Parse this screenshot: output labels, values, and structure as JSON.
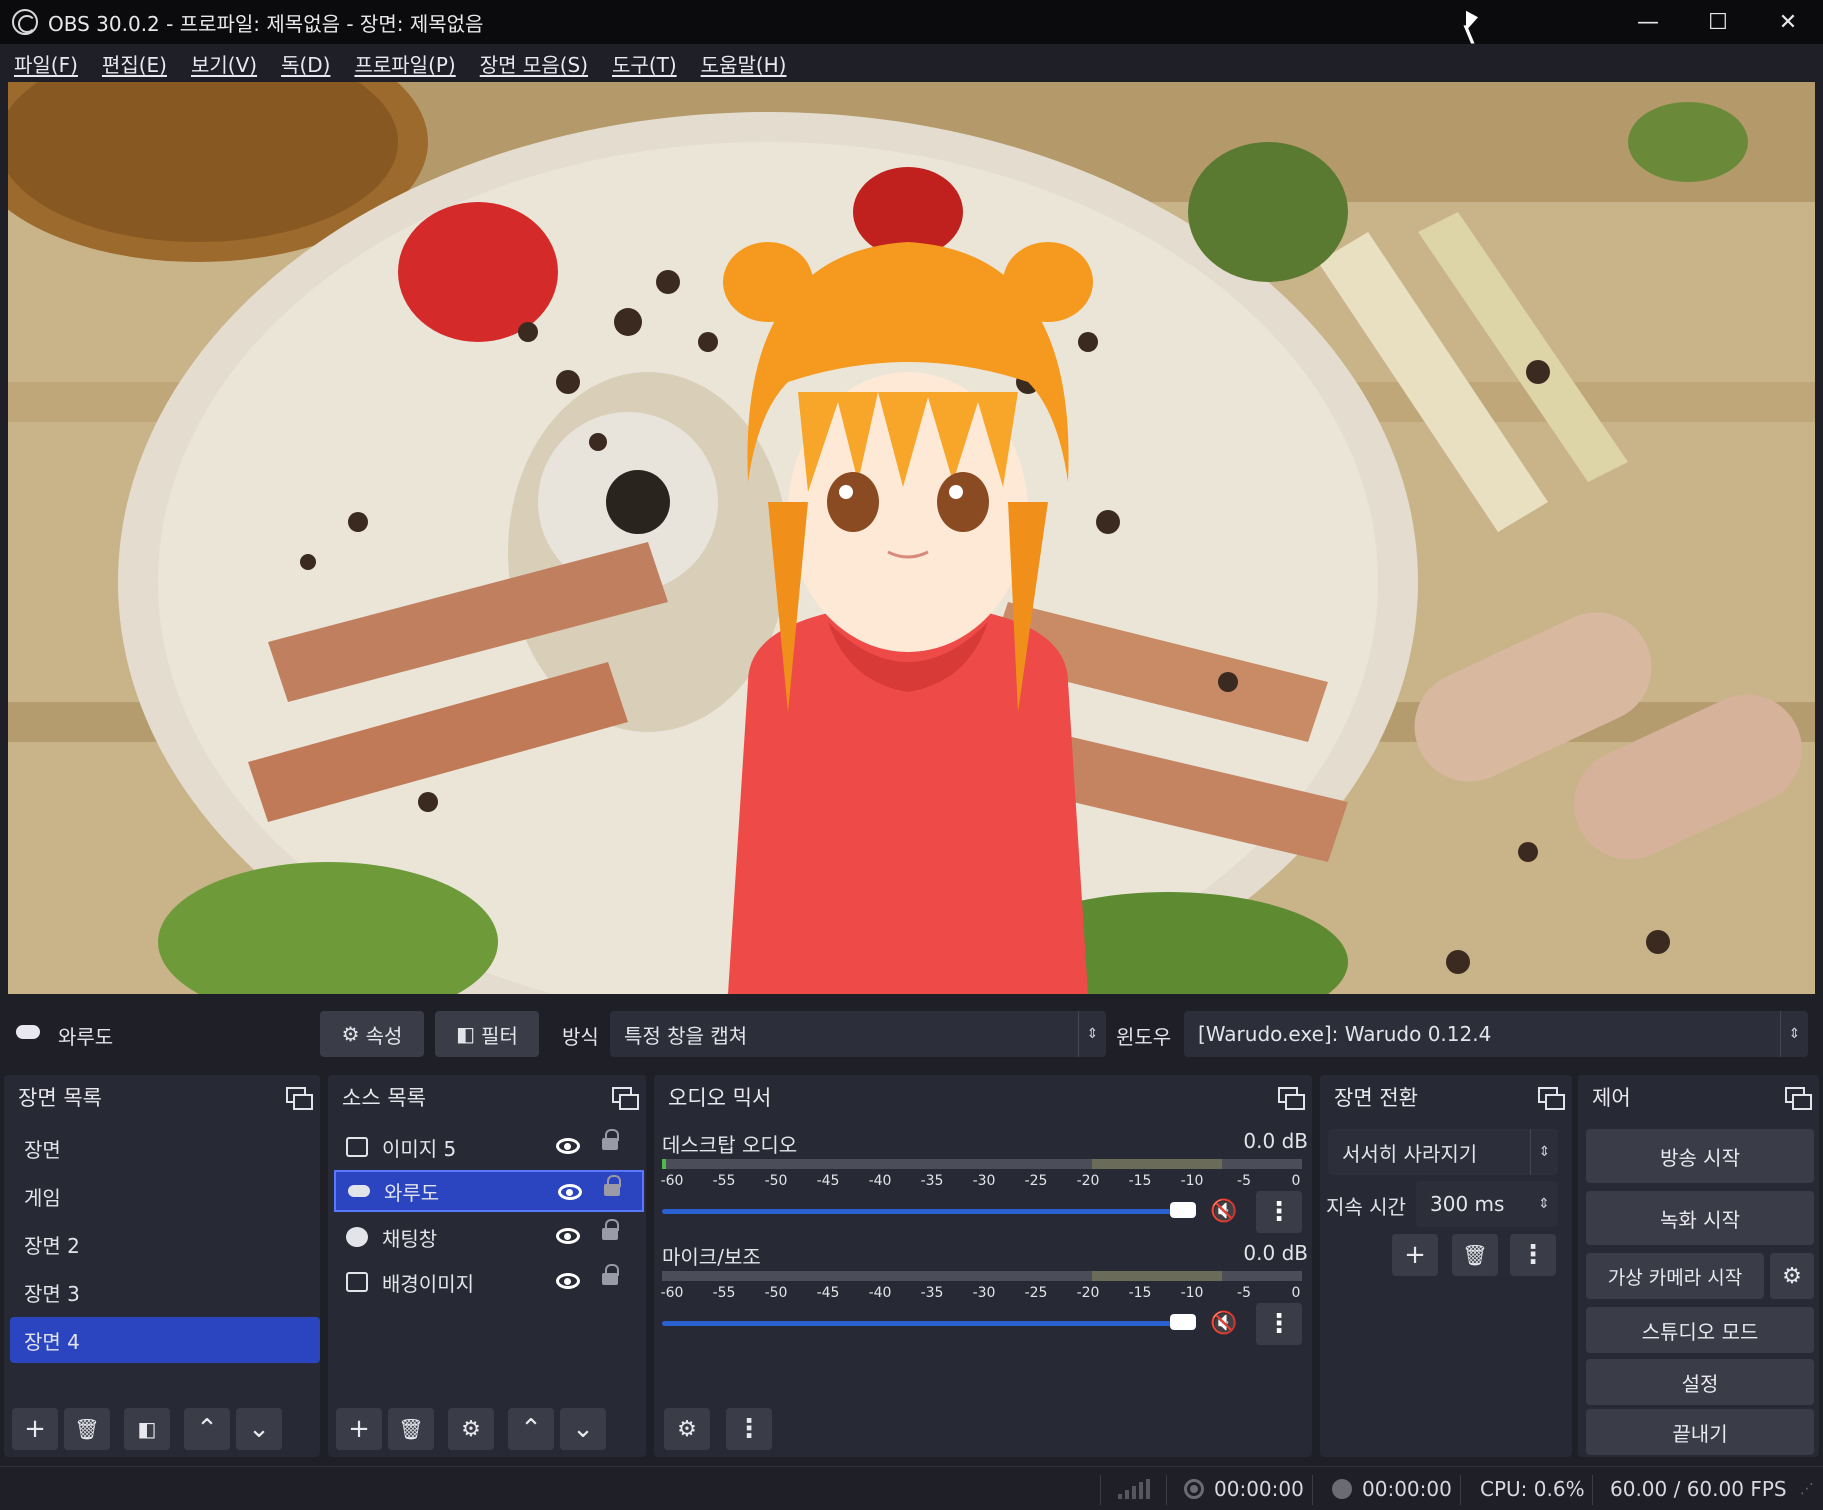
{
  "window": {
    "title": "OBS 30.0.2 - 프로파일: 제목없음 - 장면: 제목없음",
    "minimize": "—",
    "maximize": "☐",
    "close": "✕"
  },
  "menu": [
    "파일(F)",
    "편집(E)",
    "보기(V)",
    "독(D)",
    "프로파일(P)",
    "장면 모음(S)",
    "도구(T)",
    "도움말(H)"
  ],
  "source_toolbar": {
    "source_name": "와루도",
    "properties_label": "속성",
    "filters_label": "필터",
    "method_label": "방식",
    "method_value": "특정 창을 캡쳐",
    "window_label": "윈도우",
    "window_value": "[Warudo.exe]: Warudo 0.12.4"
  },
  "scenes": {
    "title": "장면 목록",
    "items": [
      "장면",
      "게임",
      "장면 2",
      "장면 3",
      "장면 4"
    ],
    "selected_index": 4
  },
  "sources": {
    "title": "소스 목록",
    "items": [
      {
        "name": "이미지 5",
        "icon": "image-icon"
      },
      {
        "name": "와루도",
        "icon": "gamepad-icon"
      },
      {
        "name": "채팅창",
        "icon": "globe-icon"
      },
      {
        "name": "배경이미지",
        "icon": "image-icon"
      }
    ],
    "selected_index": 1
  },
  "mixer": {
    "title": "오디오 믹서",
    "ticks": [
      "-60",
      "-55",
      "-50",
      "-45",
      "-40",
      "-35",
      "-30",
      "-25",
      "-20",
      "-15",
      "-10",
      "-5",
      "0"
    ],
    "channels": [
      {
        "name": "데스크탑 오디오",
        "db": "0.0 dB",
        "muted": true,
        "volume": 1.0
      },
      {
        "name": "마이크/보조",
        "db": "0.0 dB",
        "muted": true,
        "volume": 1.0
      }
    ]
  },
  "transitions": {
    "title": "장면 전환",
    "type": "서서히 사라지기",
    "duration_label": "지속 시간",
    "duration_value": "300 ms"
  },
  "controls": {
    "title": "제어",
    "start_streaming": "방송 시작",
    "start_recording": "녹화 시작",
    "start_virtual_camera": "가상 카메라 시작",
    "studio_mode": "스튜디오 모드",
    "settings": "설정",
    "exit": "끝내기"
  },
  "status": {
    "stream_time": "00:00:00",
    "record_time": "00:00:00",
    "cpu": "CPU: 0.6%",
    "fps": "60.00 / 60.00 FPS"
  },
  "colors": {
    "accent": "#2a45bf",
    "panel": "#272934",
    "button": "#3a3c48",
    "mute_red": "#e03a3a",
    "slider_blue": "#2a61d0"
  }
}
